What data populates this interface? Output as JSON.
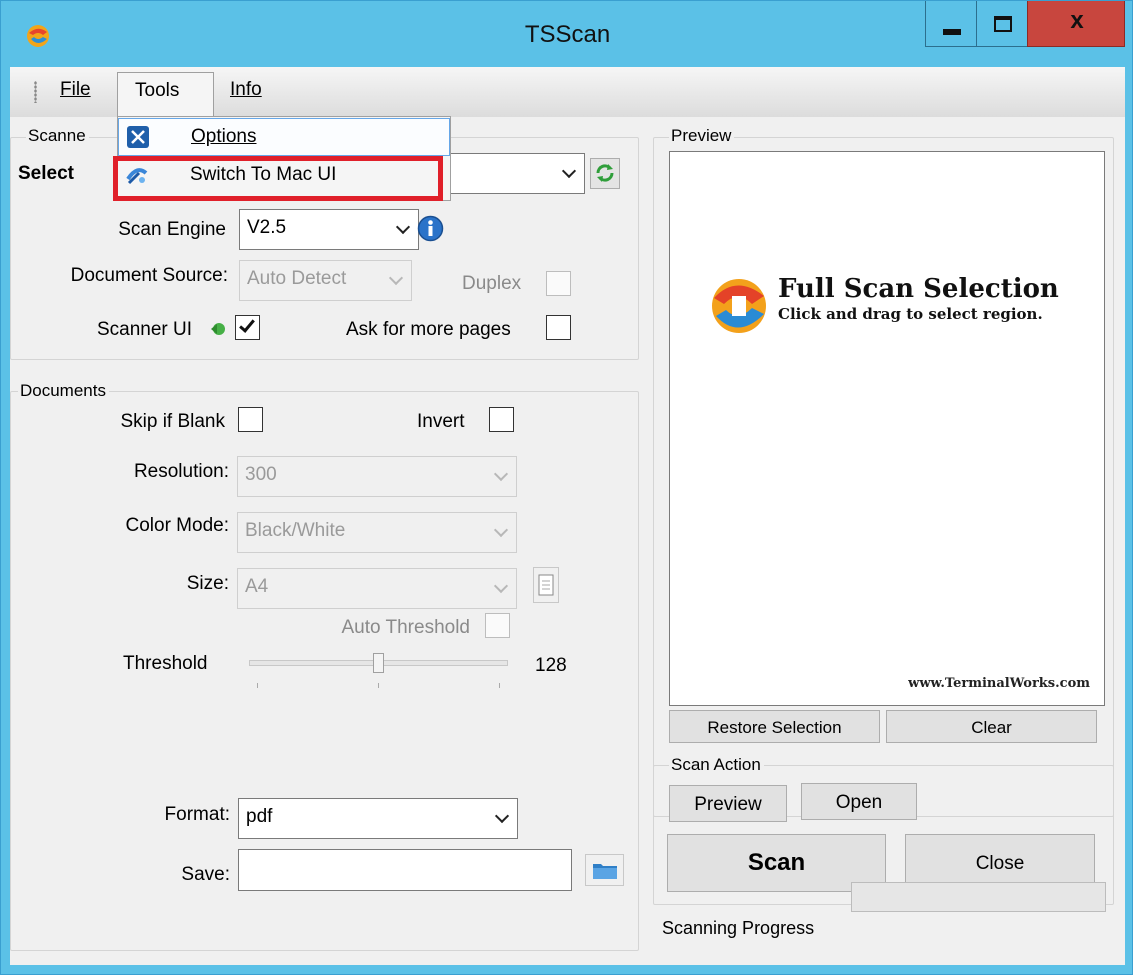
{
  "window": {
    "title": "TSScan",
    "controls": {
      "minimize": "minimize",
      "maximize": "maximize",
      "close": "x"
    }
  },
  "menubar": {
    "file": "File",
    "tools": "Tools",
    "info": "Info"
  },
  "tools_menu": {
    "items": [
      {
        "label": "Options",
        "icon": "options-tools-icon"
      },
      {
        "label": "Switch To Mac UI",
        "icon": "mac-switch-icon",
        "highlighted": true
      }
    ]
  },
  "scanner_group": {
    "legend": "Scanne",
    "select_label": "Select",
    "scan_engine_label": "Scan Engine",
    "scan_engine_value": "V2.5",
    "document_source_label": "Document Source:",
    "document_source_value": "Auto Detect",
    "duplex_label": "Duplex",
    "duplex_checked": false,
    "scanner_ui_label": "Scanner UI",
    "scanner_ui_checked": true,
    "ask_more_pages_label": "Ask for more pages",
    "ask_more_pages_checked": false
  },
  "documents_group": {
    "legend": "Documents",
    "skip_blank_label": "Skip if Blank",
    "skip_blank_checked": false,
    "invert_label": "Invert",
    "invert_checked": false,
    "resolution_label": "Resolution:",
    "resolution_value": "300",
    "color_mode_label": "Color Mode:",
    "color_mode_value": "Black/White",
    "size_label": "Size:",
    "size_value": "A4",
    "auto_threshold_label": "Auto Threshold",
    "auto_threshold_checked": false,
    "threshold_label": "Threshold",
    "threshold_value": "128",
    "threshold_fraction": 0.5,
    "format_label": "Format:",
    "format_value": "pdf",
    "save_label": "Save:",
    "save_value": ""
  },
  "preview_group": {
    "legend": "Preview",
    "heading": "Full Scan Selection",
    "subheading": "Click and drag to select region.",
    "url": "www.TerminalWorks.com",
    "restore_button": "Restore Selection",
    "clear_button": "Clear"
  },
  "scan_action_group": {
    "legend": "Scan Action",
    "preview_button": "Preview",
    "open_button": "Open",
    "scan_button": "Scan",
    "close_button": "Close"
  },
  "status": {
    "progress_label": "Scanning Progress",
    "progress_fraction": 0
  },
  "colors": {
    "titlebar": "#5bc1e7",
    "close_button": "#c8463e",
    "highlight": "#e0202a",
    "client_bg": "#f0f0f0"
  }
}
